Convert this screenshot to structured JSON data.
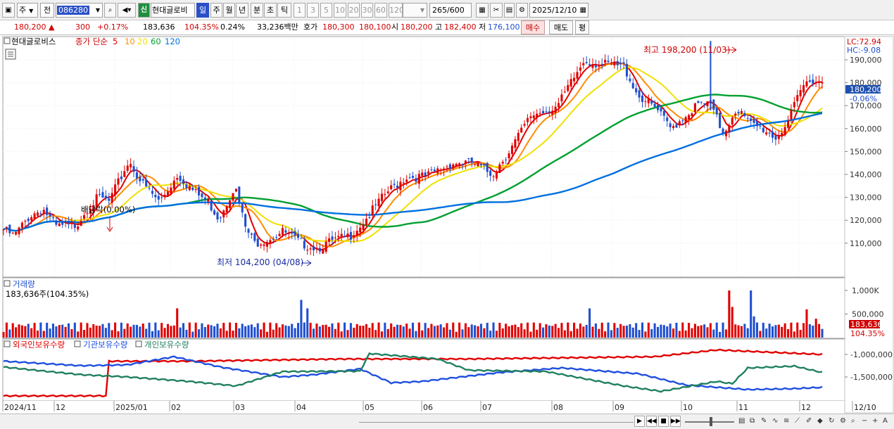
{
  "toolbar": {
    "market_type": "주",
    "market_mode": "전",
    "stock_code": "086280",
    "market_badge": "신",
    "stock_name": "현대글로비",
    "periods": [
      "일",
      "주",
      "월",
      "년",
      "분",
      "초",
      "틱"
    ],
    "active_period": "일",
    "minute_presets": [
      "1",
      "3",
      "5",
      "10",
      "20",
      "30",
      "60",
      "120"
    ],
    "count": "265",
    "count_max": "/600",
    "date": "2025/12/10"
  },
  "quote": {
    "price": "180,200",
    "price_arrow": "▲",
    "change": "300",
    "change_pct": "+0.17%",
    "volume": "183,636",
    "volume_ratio": "104.35%",
    "turnover": "0.24%",
    "amount": "33,236백만",
    "hoga_label": "호가",
    "hoga1": "180,300",
    "hoga2": "180,100",
    "open_label": "시",
    "open": "180,200",
    "high_label": "고",
    "high": "182,400",
    "low_label": "저",
    "low": "176,100",
    "buy_label": "매수",
    "sell_label": "매도",
    "avg_label": "평"
  },
  "price_panel": {
    "title": "현대글로비스",
    "ma_label": "종가 단순",
    "ma_periods": [
      "5",
      "10",
      "20",
      "60",
      "120"
    ],
    "ma_colors": [
      "#e00000",
      "#ff8c00",
      "#f0e000",
      "#00a030",
      "#0070e0"
    ],
    "lc": "LC:72.94",
    "hc": "HC:-9.08",
    "last_price": "180,200",
    "last_change": "-0.06%",
    "high_annotation": "최고 198,200 (11/03)",
    "low_annotation": "최저 104,200 (04/08)",
    "dividend_annotation": "배당락(0.00%)",
    "y_ticks": [
      "190,000",
      "180,000",
      "170,000",
      "160,000",
      "150,000",
      "140,000",
      "130,000",
      "120,000",
      "110,000"
    ]
  },
  "volume_panel": {
    "title": "거래량",
    "subtitle": "183,636주(104.35%)",
    "y_ticks": [
      "1,000K",
      "500,000"
    ],
    "last_volume": "183,636",
    "last_ratio": "104.35%"
  },
  "holding_panel": {
    "labels": [
      "외국인보유수량",
      "기관보유수량",
      "개인보유수량"
    ],
    "colors": [
      "#e00000",
      "#1f4fe0",
      "#208060"
    ],
    "y_ticks": [
      "-1,000,000",
      "-1,500,000"
    ]
  },
  "x_axis": {
    "labels": [
      "2024/11",
      "12",
      "2025/01",
      "02",
      "03",
      "04",
      "05",
      "06",
      "07",
      "08",
      "09",
      "10",
      "11",
      "12",
      "12/10"
    ]
  },
  "chart_data": {
    "type": "line",
    "title": "현대글로비스",
    "x": [
      "2024/11",
      "12",
      "2025/01",
      "02",
      "03",
      "04",
      "05",
      "06",
      "07",
      "08",
      "09",
      "10",
      "11",
      "12",
      "12/10"
    ],
    "series": [
      {
        "name": "종가 단순 120",
        "values": [
          116000,
          118000,
          119000,
          121000,
          123000,
          121000,
          120000,
          121000,
          123000,
          127000,
          138000,
          150000,
          158000,
          162000
        ]
      },
      {
        "name": "종가 단순 60",
        "values": [
          118000,
          119000,
          120000,
          124000,
          128000,
          129000,
          122000,
          116000,
          114000,
          121000,
          144000,
          164000,
          174000,
          170000
        ]
      },
      {
        "name": "종가",
        "values": [
          117000,
          115000,
          118000,
          142000,
          133000,
          108000,
          111000,
          114000,
          138000,
          147000,
          188000,
          164000,
          160000,
          180200
        ]
      }
    ],
    "ylim": [
      100000,
      200000
    ],
    "high": {
      "value": 198200,
      "date": "11/03"
    },
    "low": {
      "value": 104200,
      "date": "04/08"
    }
  }
}
